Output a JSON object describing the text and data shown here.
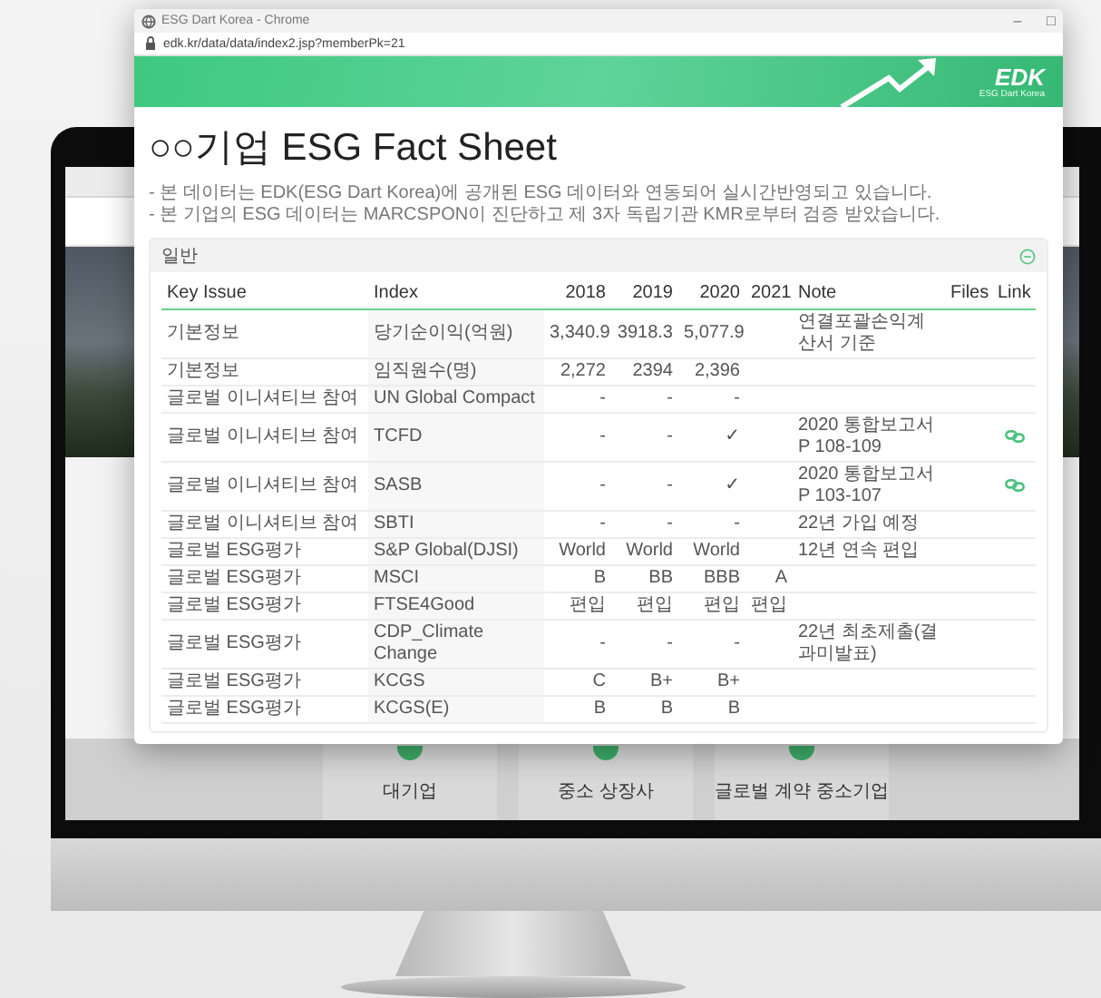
{
  "background_site": {
    "cards": [
      {
        "title": "대기업"
      },
      {
        "title": "중소 상장사"
      },
      {
        "title": "글로벌 계약 중소기업"
      }
    ]
  },
  "popup": {
    "window_title": "ESG Dart Korea - Chrome",
    "window_controls": [
      "–",
      "□"
    ],
    "url": "edk.kr/data/data/index2.jsp?memberPk=21",
    "logo": "EDK",
    "logo_subtitle": "ESG Dart Korea",
    "title": "○○기업 ESG Fact Sheet",
    "notes": [
      "- 본 데이터는 EDK(ESG Dart Korea)에 공개된 ESG 데이터와 연동되어 실시간반영되고 있습니다.",
      "- 본 기업의 ESG 데이터는 MARCSPON이 진단하고 제 3자 독립기관 KMR로부터 검증 받았습니다."
    ],
    "section": {
      "title": "일반",
      "expanded": true
    },
    "table": {
      "columns": [
        "Key Issue",
        "Index",
        "2018",
        "2019",
        "2020",
        "2021",
        "Note",
        "Files",
        "Link"
      ],
      "rows": [
        {
          "cells": [
            "기본정보",
            "당기순이익(억원)",
            "3,340.9",
            "3918.3",
            "5,077.9",
            "",
            "연결포괄손익계산서 기준"
          ],
          "link": false
        },
        {
          "cells": [
            "기본정보",
            "임직원수(명)",
            "2,272",
            "2394",
            "2,396",
            "",
            ""
          ],
          "link": false
        },
        {
          "cells": [
            "글로벌 이니셔티브 참여",
            "UN Global Compact",
            "-",
            "-",
            "-",
            "",
            ""
          ],
          "link": false
        },
        {
          "cells": [
            "글로벌 이니셔티브 참여",
            "TCFD",
            "-",
            "-",
            "✓",
            "",
            "2020 통합보고서 P 108-109"
          ],
          "link": true
        },
        {
          "cells": [
            "글로벌 이니셔티브 참여",
            "SASB",
            "-",
            "-",
            "✓",
            "",
            "2020 통합보고서 P 103-107"
          ],
          "link": true
        },
        {
          "cells": [
            "글로벌 이니셔티브 참여",
            "SBTI",
            "-",
            "-",
            "-",
            "",
            "22년 가입 예정"
          ],
          "link": false
        },
        {
          "cells": [
            "글로벌 ESG평가",
            "S&P Global(DJSI)",
            "World",
            "World",
            "World",
            "",
            "12년 연속 편입"
          ],
          "link": false
        },
        {
          "cells": [
            "글로벌 ESG평가",
            "MSCI",
            "B",
            "BB",
            "BBB",
            "A",
            ""
          ],
          "link": false
        },
        {
          "cells": [
            "글로벌 ESG평가",
            "FTSE4Good",
            "편입",
            "편입",
            "편입",
            "편입",
            ""
          ],
          "link": false
        },
        {
          "cells": [
            "글로벌 ESG평가",
            "CDP_Climate Change",
            "-",
            "-",
            "-",
            "",
            "22년 최초제출(결과미발표)"
          ],
          "link": false
        },
        {
          "cells": [
            "글로벌 ESG평가",
            "KCGS",
            "C",
            "B+",
            "B+",
            "",
            ""
          ],
          "link": false
        },
        {
          "cells": [
            "글로벌 ESG평가",
            "KCGS(E)",
            "B",
            "B",
            "B",
            "",
            ""
          ],
          "link": false
        }
      ]
    }
  }
}
